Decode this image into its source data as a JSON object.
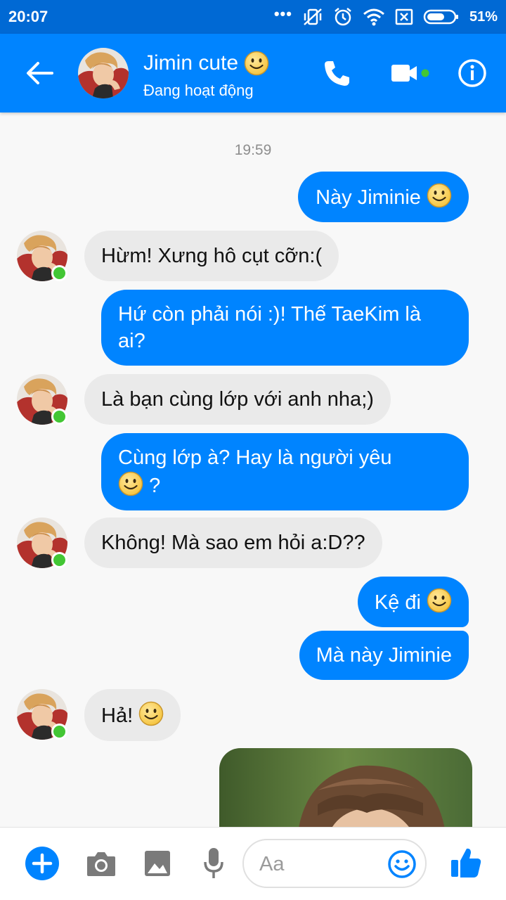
{
  "status_bar": {
    "time": "20:07",
    "overflow": "•••",
    "battery_percent": "51%",
    "icons": [
      "vibrate-off-icon",
      "alarm-icon",
      "wifi-icon",
      "no-sim-icon",
      "battery-icon"
    ]
  },
  "header": {
    "contact_name": "Jimin cute",
    "status_text": "Đang hoạt động",
    "icons": [
      "back-arrow-icon",
      "phone-icon",
      "video-camera-icon",
      "info-icon"
    ],
    "accent_color": "#0084ff",
    "online_color": "#43c634"
  },
  "chat": {
    "timestamp": "19:59",
    "messages": [
      {
        "dir": "out",
        "text": "Này Jiminie",
        "emoji": true
      },
      {
        "dir": "in",
        "text": "Hừm! Xưng hô cụt cỡn:("
      },
      {
        "dir": "out",
        "line1": "Hứ còn phải nói :)! Thế TaeKim là",
        "line2": "ai?"
      },
      {
        "dir": "in",
        "text": "Là bạn cùng lớp với anh nha;)"
      },
      {
        "dir": "out",
        "line1": "Cùng lớp à? Hay là người yêu",
        "line2_suffix": "?",
        "emoji": true
      },
      {
        "dir": "in",
        "text": "Không! Mà sao em hỏi a:D??"
      },
      {
        "dir": "out",
        "text": "Kệ đi",
        "emoji": true
      },
      {
        "dir": "out",
        "text": "Mà này Jiminie"
      },
      {
        "dir": "in",
        "text": "Hả!",
        "emoji": true
      },
      {
        "dir": "out",
        "type": "photo"
      }
    ],
    "outgoing_color": "#0084ff",
    "incoming_color": "#eaeaea"
  },
  "composer": {
    "placeholder": "Aa",
    "icons": [
      "plus-icon",
      "camera-icon",
      "gallery-icon",
      "microphone-icon",
      "emoji-icon",
      "thumbs-up-icon"
    ]
  }
}
